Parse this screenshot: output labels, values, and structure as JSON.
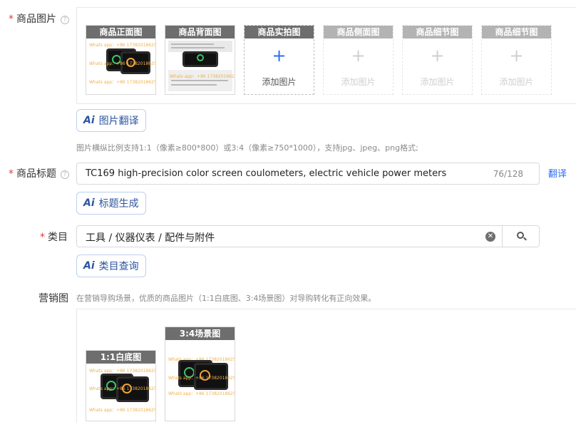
{
  "product_images": {
    "label": "商品图片",
    "help": "?",
    "slots": [
      {
        "caption": "商品正面图",
        "state": "filled"
      },
      {
        "caption": "商品背面图",
        "state": "filled"
      },
      {
        "caption": "商品实拍图",
        "state": "empty",
        "add_label": "添加图片",
        "plus": "+"
      },
      {
        "caption": "商品侧面图",
        "state": "disabled",
        "add_label": "添加图片",
        "plus": "+"
      },
      {
        "caption": "商品细节图",
        "state": "disabled",
        "add_label": "添加图片",
        "plus": "+"
      },
      {
        "caption": "商品细节图",
        "state": "disabled",
        "add_label": "添加图片",
        "plus": "+"
      }
    ],
    "translate_button": "图片翻译",
    "hint": "图片横纵比例支持1:1（像素≥800*800）或3:4（像素≥750*1000），支持jpg、jpeg、png格式;"
  },
  "watermark_text": "Whats app：+86 17382018625",
  "product_title": {
    "label": "商品标题",
    "help": "?",
    "value": "TC169 high-precision color screen coulometers, electric vehicle power meters",
    "count": "76/128",
    "translate_link": "翻译",
    "generate_button": "标题生成"
  },
  "category": {
    "label": "类目",
    "value": "工具 / 仪器仪表 / 配件与附件",
    "query_button": "类目查询"
  },
  "marketing": {
    "label": "营销图",
    "hint": "在营销导购场景，优质的商品图片（1:1白底图、3:4场景图）对导购转化有正向效果。",
    "square_caption": "1:1白底图",
    "portrait_caption": "3:4场景图"
  },
  "ai_badge": "Ai",
  "required_mark": "*",
  "colors": {
    "accent": "#2b6ef0",
    "required": "#e23c39",
    "caption_bg": "#6e6e6e"
  }
}
